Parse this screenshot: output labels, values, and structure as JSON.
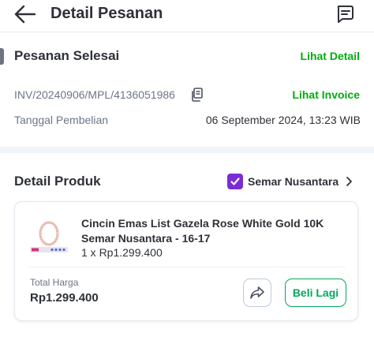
{
  "header": {
    "title": "Detail Pesanan",
    "back_icon": "arrow-left-icon",
    "chat_icon": "chat-icon"
  },
  "order": {
    "status": "Pesanan Selesai",
    "detail_link": "Lihat Detail",
    "invoice_number": "INV/20240906/MPL/4136051986",
    "copy_icon": "copy-icon",
    "invoice_link": "Lihat Invoice",
    "purchase_date_label": "Tanggal Pembelian",
    "purchase_date": "06 September 2024, 13:23 WIB"
  },
  "product_section": {
    "title": "Detail Produk",
    "shop_badge_icon": "checkmark-badge-icon",
    "shop_name": "Semar Nusantara",
    "chevron_icon": "chevron-right-icon"
  },
  "product": {
    "name": "Cincin Emas List Gazela Rose White Gold 10K Semar Nusantara - 16-17",
    "quantity_price": "1 x Rp1.299.400",
    "total_label": "Total Harga",
    "total_value": "Rp1.299.400",
    "share_icon": "share-icon",
    "buy_again": "Beli Lagi"
  },
  "colors": {
    "accent_green": "#03ac0e",
    "badge_purple": "#7b2cd6",
    "text_primary": "#2e3137",
    "text_secondary": "#6d7588"
  }
}
